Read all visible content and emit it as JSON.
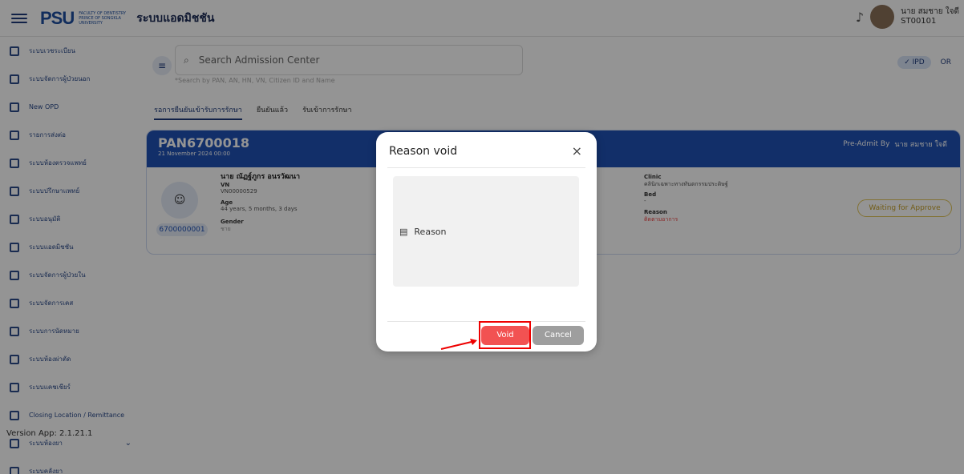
{
  "header": {
    "title": "ระบบแอดมิชชัน",
    "logo": "PSU",
    "logo_sub": "FACULTY OF DENTISTRY PRINCE OF SONGKLA UNIVERSITY",
    "user_name": "นาย สมชาย ใจดี",
    "user_id": "ST00101"
  },
  "sidebar": {
    "items": [
      {
        "label": "ระบบเวชระเบียน"
      },
      {
        "label": "ระบบจัดการผู้ป่วยนอก"
      },
      {
        "label": "New OPD"
      },
      {
        "label": "รายการส่งต่อ"
      },
      {
        "label": "ระบบห้องตรวจแพทย์"
      },
      {
        "label": "ระบบปรึกษาแพทย์"
      },
      {
        "label": "ระบบอนุมัติ"
      },
      {
        "label": "ระบบแอดมิชชัน"
      },
      {
        "label": "ระบบจัดการผู้ป่วยใน"
      },
      {
        "label": "ระบบจัดการเคส"
      },
      {
        "label": "ระบบการนัดหมาย"
      },
      {
        "label": "ระบบห้องผ่าตัด"
      },
      {
        "label": "ระบบแคชเชียร์"
      },
      {
        "label": "Closing Location / Remittance"
      },
      {
        "label": "ระบบห้องยา"
      },
      {
        "label": "ระบบคลังยา"
      }
    ],
    "version": "Version App: 2.1.21.1"
  },
  "main": {
    "search_placeholder": "Search Admission Center",
    "search_hint": "*Search by PAN, AN, HN, VN, Citizen ID and Name",
    "toggle_ipd": "✓ IPD",
    "toggle_or": "OR",
    "tabs": [
      "รอการยืนยันเข้ารับการรักษา",
      "ยืนยันแล้ว",
      "รับเข้าการรักษา"
    ],
    "card": {
      "pan": "PAN6700018",
      "date": "21 November 2024 00:00",
      "pre_admit_label": "Pre-Admit By",
      "pre_admit_name": "นาย สมชาย ใจดี",
      "patient_name": "นาย ณัฏฐ์ภูกร อนรวัฒนา",
      "hn": "6700000001",
      "vn_label": "VN",
      "vn": "VN00000529",
      "age_label": "Age",
      "age": "44 years, 5 months, 3 days",
      "gender_label": "Gender",
      "gender": "ชาย",
      "clinic_label": "Clinic",
      "clinic": "คลินิกเฉพาะทางทันตกรรมประดิษฐ์",
      "bed_label": "Bed",
      "bed": "-",
      "reason_label": "Reason",
      "reason": "ติดตามอาการ",
      "status": "Waiting for Approve"
    }
  },
  "modal": {
    "title": "Reason void",
    "close": "×",
    "reason_placeholder": "Reason",
    "void_label": "Void",
    "cancel_label": "Cancel"
  },
  "colors": {
    "primary": "#2052b5",
    "danger": "#f25252",
    "highlight": "#e00000"
  }
}
